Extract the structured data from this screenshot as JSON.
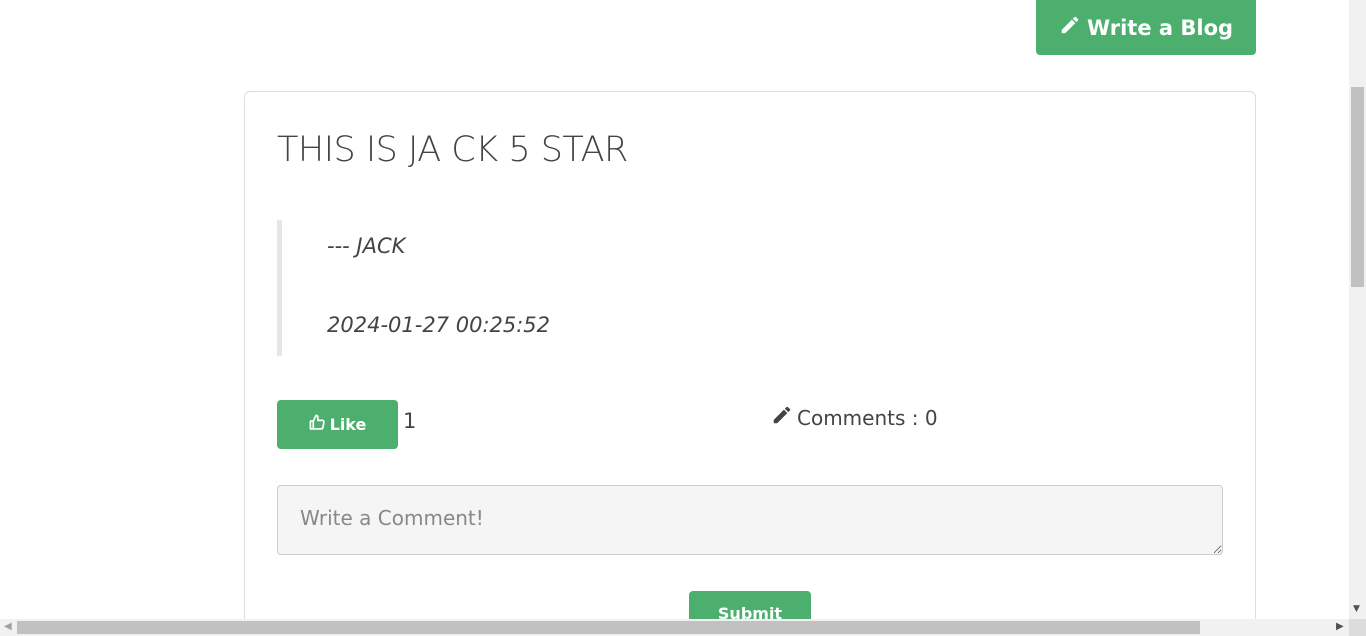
{
  "header": {
    "write_blog_label": "Write a Blog",
    "write_blog_icon": "pencil-icon"
  },
  "post": {
    "title": "THIS IS JA CK 5 STAR",
    "author": "--- JACK",
    "date": "2024-01-27 00:25:52"
  },
  "actions": {
    "like_label": "Like",
    "like_icon": "thumbs-up-icon",
    "like_count": "1",
    "comments_label": "Comments : 0",
    "comments_icon": "pencil-icon"
  },
  "comment_form": {
    "placeholder": "Write a Comment!",
    "value": "",
    "submit_label": "Submit"
  },
  "colors": {
    "accent": "#4caf6e",
    "text": "#444444",
    "border": "#dddddd"
  }
}
